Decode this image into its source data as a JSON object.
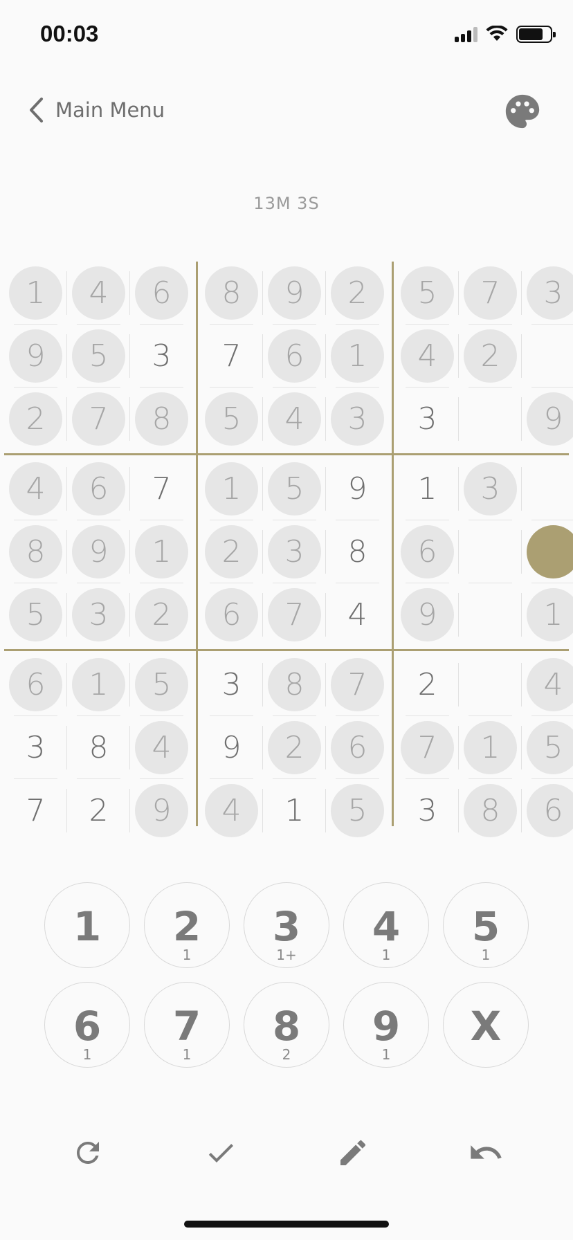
{
  "status_bar": {
    "time": "00:03"
  },
  "header": {
    "back_label": "Main Menu",
    "back_icon": "chevron-left-icon",
    "theme_icon": "palette-icon"
  },
  "timer": "13M 3S",
  "accent_color": "#ab9f72",
  "board": {
    "grid": [
      [
        "1",
        "4",
        "6",
        "8",
        "9",
        "2",
        "5",
        "7",
        "3"
      ],
      [
        "9",
        "5",
        "3",
        "7",
        "6",
        "1",
        "4",
        "2",
        ""
      ],
      [
        "2",
        "7",
        "8",
        "5",
        "4",
        "3",
        "3",
        "",
        "9"
      ],
      [
        "4",
        "6",
        "7",
        "1",
        "5",
        "9",
        "1",
        "3",
        ""
      ],
      [
        "8",
        "9",
        "1",
        "2",
        "3",
        "8",
        "6",
        "",
        ""
      ],
      [
        "5",
        "3",
        "2",
        "6",
        "7",
        "4",
        "9",
        "",
        "1"
      ],
      [
        "6",
        "1",
        "5",
        "3",
        "8",
        "7",
        "2",
        "",
        "4"
      ],
      [
        "3",
        "8",
        "4",
        "9",
        "2",
        "6",
        "7",
        "1",
        "5"
      ],
      [
        "7",
        "2",
        "9",
        "4",
        "1",
        "5",
        "3",
        "8",
        "6"
      ]
    ],
    "givens": [
      [
        1,
        1,
        1,
        1,
        1,
        1,
        1,
        1,
        1
      ],
      [
        1,
        1,
        0,
        0,
        1,
        1,
        1,
        1,
        0
      ],
      [
        1,
        1,
        1,
        1,
        1,
        1,
        0,
        0,
        1
      ],
      [
        1,
        1,
        0,
        1,
        1,
        0,
        0,
        1,
        0
      ],
      [
        1,
        1,
        1,
        1,
        1,
        0,
        1,
        0,
        0
      ],
      [
        1,
        1,
        1,
        1,
        1,
        0,
        1,
        0,
        1
      ],
      [
        1,
        1,
        1,
        0,
        1,
        1,
        0,
        0,
        1
      ],
      [
        0,
        0,
        1,
        0,
        1,
        1,
        1,
        1,
        1
      ],
      [
        0,
        0,
        1,
        1,
        0,
        1,
        0,
        1,
        1
      ]
    ],
    "selected_cell": {
      "row": 4,
      "col": 8
    }
  },
  "keypad": [
    {
      "label": "1",
      "count": ""
    },
    {
      "label": "2",
      "count": "1"
    },
    {
      "label": "3",
      "count": "1+"
    },
    {
      "label": "4",
      "count": "1"
    },
    {
      "label": "5",
      "count": "1"
    },
    {
      "label": "6",
      "count": "1"
    },
    {
      "label": "7",
      "count": "1"
    },
    {
      "label": "8",
      "count": "2"
    },
    {
      "label": "9",
      "count": "1"
    },
    {
      "label": "X",
      "count": ""
    }
  ],
  "toolbar": [
    "restart-icon",
    "check-icon",
    "pencil-icon",
    "undo-icon"
  ]
}
